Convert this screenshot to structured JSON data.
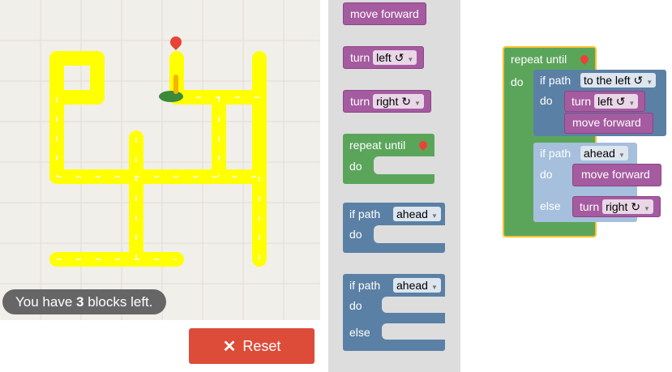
{
  "status": {
    "prefix": "You have ",
    "count": "3",
    "suffix": " blocks left."
  },
  "reset": {
    "label": "Reset",
    "icon": "close-icon"
  },
  "toolbox": {
    "move_forward": "move forward",
    "turn_left": {
      "label": "turn",
      "value": "left ↺"
    },
    "turn_right": {
      "label": "turn",
      "value": "right ↻"
    },
    "repeat_until": {
      "label": "repeat until",
      "do": "do"
    },
    "if_path": {
      "label": "if path",
      "value": "ahead",
      "do": "do"
    },
    "if_else": {
      "label": "if path",
      "value": "ahead",
      "do": "do",
      "else": "else"
    }
  },
  "workspace": {
    "repeat_until": "repeat until",
    "repeat_do": "do",
    "if1": {
      "label": "if path",
      "value": "to the left ↺",
      "do": "do"
    },
    "if1_turn": {
      "label": "turn",
      "value": "left ↺"
    },
    "if1_move": "move forward",
    "if2": {
      "label": "if path",
      "value": "ahead",
      "do": "do",
      "else": "else"
    },
    "if2_move": "move forward",
    "if2_turn": {
      "label": "turn",
      "value": "right ↻"
    }
  },
  "colors": {
    "path": "#ffff00",
    "reset": "#dd4b39",
    "motion": "#a55b9f",
    "loop": "#5ba55b",
    "logic": "#5b80a5",
    "logic_light": "#a5bfdc"
  }
}
